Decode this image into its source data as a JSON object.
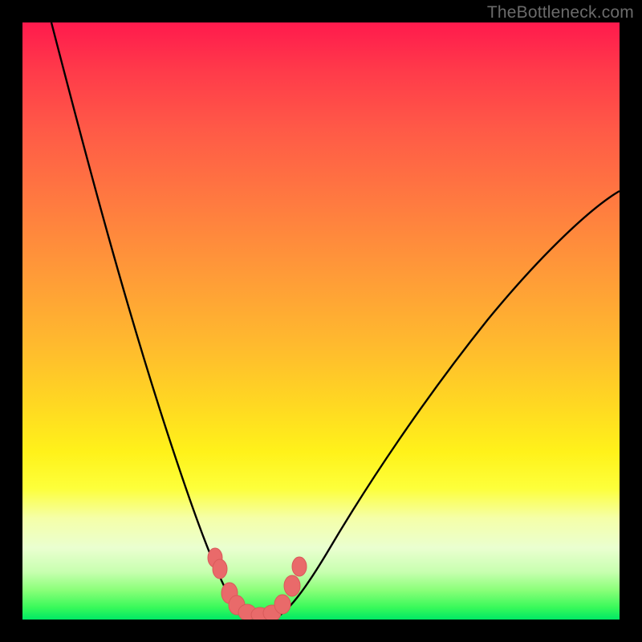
{
  "watermark": "TheBottleneck.com",
  "chart_data": {
    "type": "line",
    "title": "",
    "xlabel": "",
    "ylabel": "",
    "xlim": [
      0,
      100
    ],
    "ylim": [
      0,
      100
    ],
    "grid": false,
    "background_gradient": {
      "stops": [
        {
          "pos": 0,
          "color": "#ff1a4d"
        },
        {
          "pos": 30,
          "color": "#ff7a40"
        },
        {
          "pos": 64,
          "color": "#ffd822"
        },
        {
          "pos": 83,
          "color": "#f5ffa8"
        },
        {
          "pos": 100,
          "color": "#00e865"
        }
      ]
    },
    "series": [
      {
        "name": "left-branch",
        "style": "curve",
        "color": "#000000",
        "x": [
          5,
          10,
          15,
          20,
          25,
          28,
          30,
          32,
          34,
          36
        ],
        "y": [
          100,
          80,
          60,
          42,
          26,
          17,
          11,
          6,
          3,
          1
        ]
      },
      {
        "name": "right-branch",
        "style": "curve",
        "color": "#000000",
        "x": [
          42,
          45,
          50,
          55,
          60,
          70,
          80,
          90,
          100
        ],
        "y": [
          1,
          4,
          12,
          22,
          31,
          46,
          57,
          65,
          71
        ]
      },
      {
        "name": "valley-markers",
        "style": "scatter",
        "color": "#e96a6a",
        "x": [
          31,
          32,
          34,
          35,
          37,
          39,
          41,
          42,
          44,
          45
        ],
        "y": [
          11,
          9,
          4,
          2,
          1,
          1,
          1,
          3,
          6,
          10
        ]
      }
    ]
  }
}
